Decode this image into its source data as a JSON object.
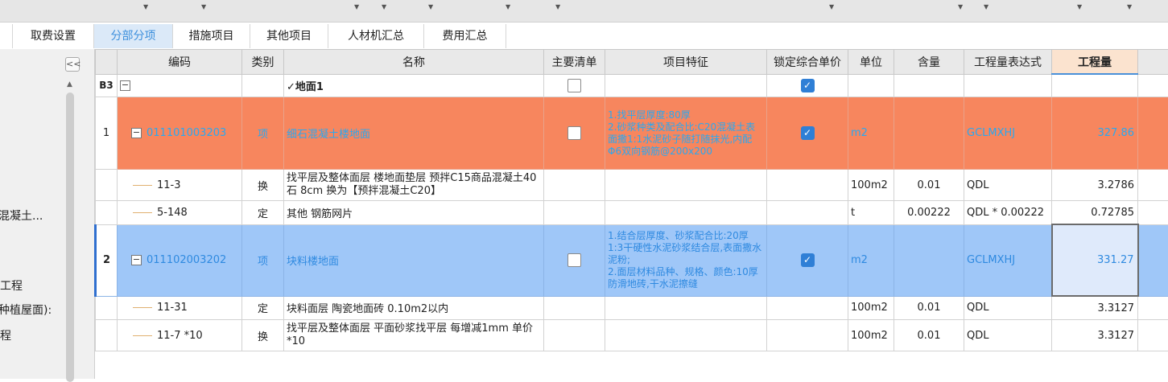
{
  "tabs": [
    {
      "label": "取费设置",
      "active": false
    },
    {
      "label": "分部分项",
      "active": true
    },
    {
      "label": "措施项目",
      "active": false
    },
    {
      "label": "其他项目",
      "active": false
    },
    {
      "label": "人材机汇总",
      "active": false
    },
    {
      "label": "费用汇总",
      "active": false
    }
  ],
  "left_panel": {
    "collapse_label": "<<",
    "items": [
      "混凝土...",
      "工程",
      "种植屋面):",
      "程"
    ]
  },
  "columns": [
    "编码",
    "类别",
    "名称",
    "主要清单",
    "项目特征",
    "锁定综合单价",
    "单位",
    "含量",
    "工程量表达式",
    "工程量"
  ],
  "rows": [
    {
      "num": "B3",
      "code": "",
      "type": "",
      "name": "✓地面1",
      "main": false,
      "feature": "",
      "locked": true,
      "unit": "",
      "qty_content": "",
      "expr": "",
      "qty": ""
    },
    {
      "num": "1",
      "code": "011101003203",
      "type": "项",
      "name": "细石混凝土楼地面",
      "main": false,
      "feature": "1.找平层厚度:80厚\n2.砂浆种类及配合比:C20混凝土表面撒1:1水泥砂子随打随抹光,内配Φ6双向钢筋@200x200",
      "locked": true,
      "unit": "m2",
      "qty_content": "",
      "expr": "GCLMXHJ",
      "qty": "327.86"
    },
    {
      "num": "",
      "code": "11-3",
      "type": "换",
      "name": "找平层及整体面层 楼地面垫层 预拌C15商品混凝土40石 8cm  换为【预拌混凝土C20】",
      "main": null,
      "feature": "",
      "locked": null,
      "unit": "100m2",
      "qty_content": "0.01",
      "expr": "QDL",
      "qty": "3.2786"
    },
    {
      "num": "",
      "code": "5-148",
      "type": "定",
      "name": "其他 钢筋网片",
      "main": null,
      "feature": "",
      "locked": null,
      "unit": "t",
      "qty_content": "0.00222",
      "expr": "QDL * 0.00222",
      "qty": "0.72785"
    },
    {
      "num": "2",
      "code": "011102003202",
      "type": "项",
      "name": "块料楼地面",
      "main": false,
      "feature": "1.结合层厚度、砂浆配合比:20厚1:3干硬性水泥砂浆结合层,表面撒水泥粉;\n2.面层材料品种、规格、颜色:10厚防滑地砖,干水泥擦缝",
      "locked": true,
      "unit": "m2",
      "qty_content": "",
      "expr": "GCLMXHJ",
      "qty": "331.27"
    },
    {
      "num": "",
      "code": "11-31",
      "type": "定",
      "name": "块料面层 陶瓷地面砖 0.10m2以内",
      "main": null,
      "feature": "",
      "locked": null,
      "unit": "100m2",
      "qty_content": "0.01",
      "expr": "QDL",
      "qty": "3.3127"
    },
    {
      "num": "",
      "code": "11-7 *10",
      "type": "换",
      "name": "找平层及整体面层 平面砂浆找平层 每增减1mm  单价*10",
      "main": null,
      "feature": "",
      "locked": null,
      "unit": "100m2",
      "qty_content": "0.01",
      "expr": "QDL",
      "qty": "3.3127"
    }
  ]
}
